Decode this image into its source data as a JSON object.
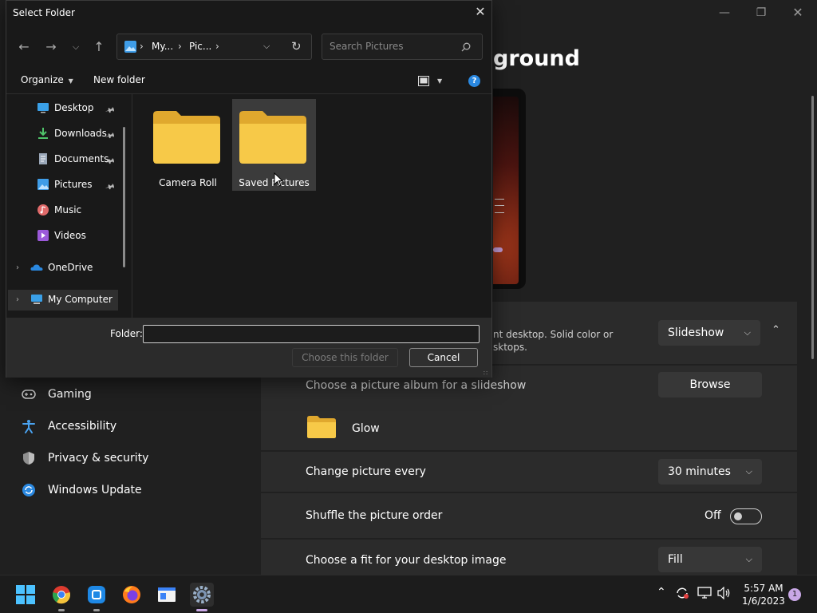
{
  "settings": {
    "title": "ground",
    "personalize_desc_line1": "nt desktop. Solid color or",
    "personalize_desc_line2": "sktops.",
    "background_type": "Slideshow",
    "album_label": "Choose a picture album for a slideshow",
    "browse_label": "Browse",
    "album_name": "Glow",
    "change_every_label": "Change picture every",
    "change_every_value": "30 minutes",
    "shuffle_label": "Shuffle the picture order",
    "shuffle_state": "Off",
    "fit_label": "Choose a fit for your desktop image",
    "fit_value": "Fill",
    "nav": [
      {
        "label": "Gaming",
        "icon": "gamepad-icon"
      },
      {
        "label": "Accessibility",
        "icon": "accessibility-icon"
      },
      {
        "label": "Privacy & security",
        "icon": "shield-icon"
      },
      {
        "label": "Windows Update",
        "icon": "update-icon"
      }
    ]
  },
  "dialog": {
    "title": "Select Folder",
    "address": {
      "crumbs": [
        "My...",
        "Pic..."
      ]
    },
    "search_placeholder": "Search Pictures",
    "toolbar": {
      "organize": "Organize",
      "new_folder": "New folder"
    },
    "tree": [
      {
        "label": "Desktop",
        "icon": "desktop-icon",
        "pinned": true
      },
      {
        "label": "Downloads",
        "icon": "downloads-icon",
        "pinned": true
      },
      {
        "label": "Documents",
        "icon": "documents-icon",
        "pinned": true
      },
      {
        "label": "Pictures",
        "icon": "pictures-icon",
        "pinned": true
      },
      {
        "label": "Music",
        "icon": "music-icon",
        "pinned": false
      },
      {
        "label": "Videos",
        "icon": "videos-icon",
        "pinned": false
      },
      {
        "label": "OneDrive",
        "icon": "onedrive-icon",
        "pinned": false
      },
      {
        "label": "My Computer",
        "icon": "computer-icon",
        "pinned": false
      }
    ],
    "folders": [
      {
        "label": "Camera Roll"
      },
      {
        "label": "Saved Pictures"
      }
    ],
    "folder_field_label": "Folder:",
    "folder_value": "",
    "choose_button": "Choose this folder",
    "cancel_button": "Cancel"
  },
  "taskbar": {
    "apps": [
      "start-icon",
      "chrome-icon",
      "app-icon",
      "firefox-icon",
      "file-explorer-icon",
      "settings-icon"
    ],
    "time": "5:57 AM",
    "date": "1/6/2023",
    "notifications": "1"
  },
  "colors": {
    "accent": "#2a88e0",
    "folder_yellow": "#f7c948",
    "indicator": "#c9a8e6"
  }
}
